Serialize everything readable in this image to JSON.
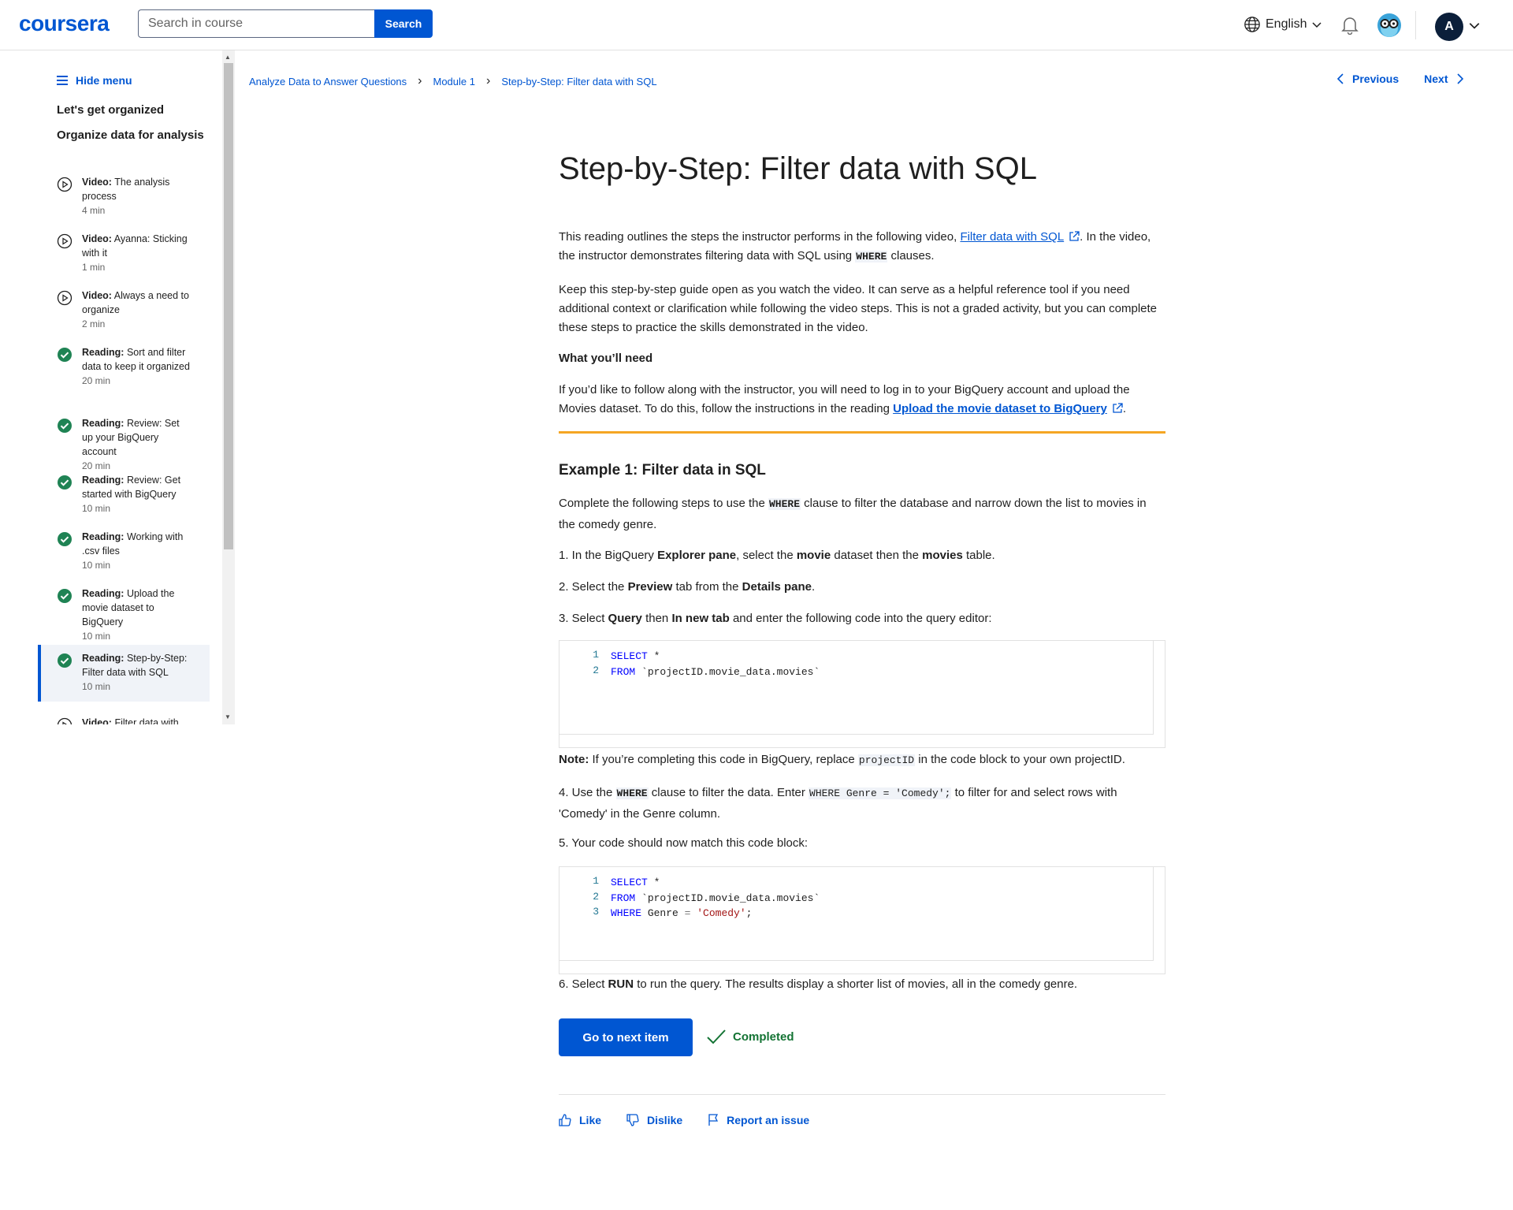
{
  "header": {
    "logo": "coursera",
    "search_placeholder": "Search in course",
    "search_button": "Search",
    "language": "English",
    "avatar_initial": "A"
  },
  "sidebar": {
    "hide_menu": "Hide menu",
    "section1": "Let's get organized",
    "section2": "Organize data for analysis",
    "items": [
      {
        "type": "Video:",
        "title": "The analysis process",
        "duration": "4 min",
        "icon": "play-icon"
      },
      {
        "type": "Video:",
        "title": "Ayanna: Sticking with it",
        "duration": "1 min",
        "icon": "play-icon"
      },
      {
        "type": "Video:",
        "title": "Always a need to organize",
        "duration": "2 min",
        "icon": "play-icon"
      },
      {
        "type": "Reading:",
        "title": "Sort and filter data to keep it organized",
        "duration": "20 min",
        "icon": "check-circle-icon"
      },
      {
        "type": "Reading:",
        "title": "Review: Set up your BigQuery account",
        "duration": "20 min",
        "icon": "check-circle-icon"
      },
      {
        "type": "Reading:",
        "title": "Review: Get started with BigQuery",
        "duration": "10 min",
        "icon": "check-circle-icon"
      },
      {
        "type": "Reading:",
        "title": "Working with .csv files",
        "duration": "10 min",
        "icon": "check-circle-icon"
      },
      {
        "type": "Reading:",
        "title": "Upload the movie dataset to BigQuery",
        "duration": "10 min",
        "icon": "check-circle-icon"
      },
      {
        "type": "Reading:",
        "title": "Step-by-Step: Filter data with SQL",
        "duration": "10 min",
        "icon": "check-circle-icon",
        "active": true
      },
      {
        "type": "Video:",
        "title": "Filter data with",
        "duration": "",
        "icon": "play-icon"
      }
    ]
  },
  "breadcrumb": [
    "Analyze Data to Answer Questions",
    "Module 1",
    "Step-by-Step: Filter data with SQL"
  ],
  "nav": {
    "previous": "Previous",
    "next": "Next"
  },
  "content": {
    "title": "Step-by-Step: Filter data with SQL",
    "intro_1a": "This reading outlines the steps the instructor performs in the following video, ",
    "intro_link": "Filter data with SQL",
    "intro_1b": ". In the video, the instructor demonstrates filtering data with SQL using ",
    "intro_code": "WHERE",
    "intro_1c": " clauses.",
    "para2": "Keep this step-by-step guide open as you watch the video. It can serve as a helpful reference tool if you need additional context or clarification while following the video steps. This is not a graded activity, but you can complete these steps to practice the skills demonstrated in the video.",
    "need_heading": "What you’ll need",
    "need_a": "If you’d like to follow along with the instructor, you will need to log in to your BigQuery account and upload the Movies dataset. To do this, follow the instructions in the reading ",
    "need_link": "Upload the movie dataset to BigQuery",
    "need_b": ".",
    "example_heading": "Example 1: Filter data in SQL",
    "ex_a": "Complete the following steps to use the ",
    "ex_code": "WHERE",
    "ex_b": " clause to filter the database and narrow down the list to movies in the comedy genre.",
    "step1_a": "1. In the BigQuery ",
    "step1_b": "Explorer pane",
    "step1_c": ", select the ",
    "step1_d": "movie",
    "step1_e": " dataset then the ",
    "step1_f": "movies",
    "step1_g": " table.",
    "step2_a": "2. Select the ",
    "step2_b": "Preview",
    "step2_c": " tab from the ",
    "step2_d": "Details pane",
    "step2_e": ".",
    "step3_a": "3. Select ",
    "step3_b": "Query",
    "step3_c": " then ",
    "step3_d": "In new tab",
    "step3_e": " and enter the following code into the query editor:",
    "code1": [
      {
        "n": "1",
        "kw": "SELECT",
        "rest": " *"
      },
      {
        "n": "2",
        "kw": "FROM",
        "rest": " `projectID.movie_data.movies`"
      }
    ],
    "note_a": "Note:",
    "note_b": " If you’re completing this code in BigQuery, replace ",
    "note_code": "projectID",
    "note_c": " in the code block to your own projectID.",
    "step4_a": "4. Use the ",
    "step4_code1": "WHERE",
    "step4_b": " clause to filter the data. Enter ",
    "step4_code2": "WHERE Genre = 'Comedy';",
    "step4_c": " to filter for and select rows with 'Comedy' in the Genre column.",
    "step5": "5. Your code should now match this code block:",
    "code2": [
      {
        "n": "1",
        "kw": "SELECT",
        "rest": " *"
      },
      {
        "n": "2",
        "kw": "FROM",
        "rest": " `projectID.movie_data.movies`"
      },
      {
        "n": "3",
        "kw": "WHERE",
        "rest": " Genre ",
        "op": "=",
        "str": "'Comedy'",
        "end": ";"
      }
    ],
    "step6_a": "6. Select ",
    "step6_b": "RUN",
    "step6_c": " to run the query. The results display a shorter list of movies, all in the comedy genre.",
    "next_button": "Go to next item",
    "completed": "Completed"
  },
  "feedback": {
    "like": "Like",
    "dislike": "Dislike",
    "report": "Report an issue"
  },
  "colors": {
    "brand": "#0056d2",
    "accent_rule": "#f5a623",
    "success": "#137333"
  }
}
